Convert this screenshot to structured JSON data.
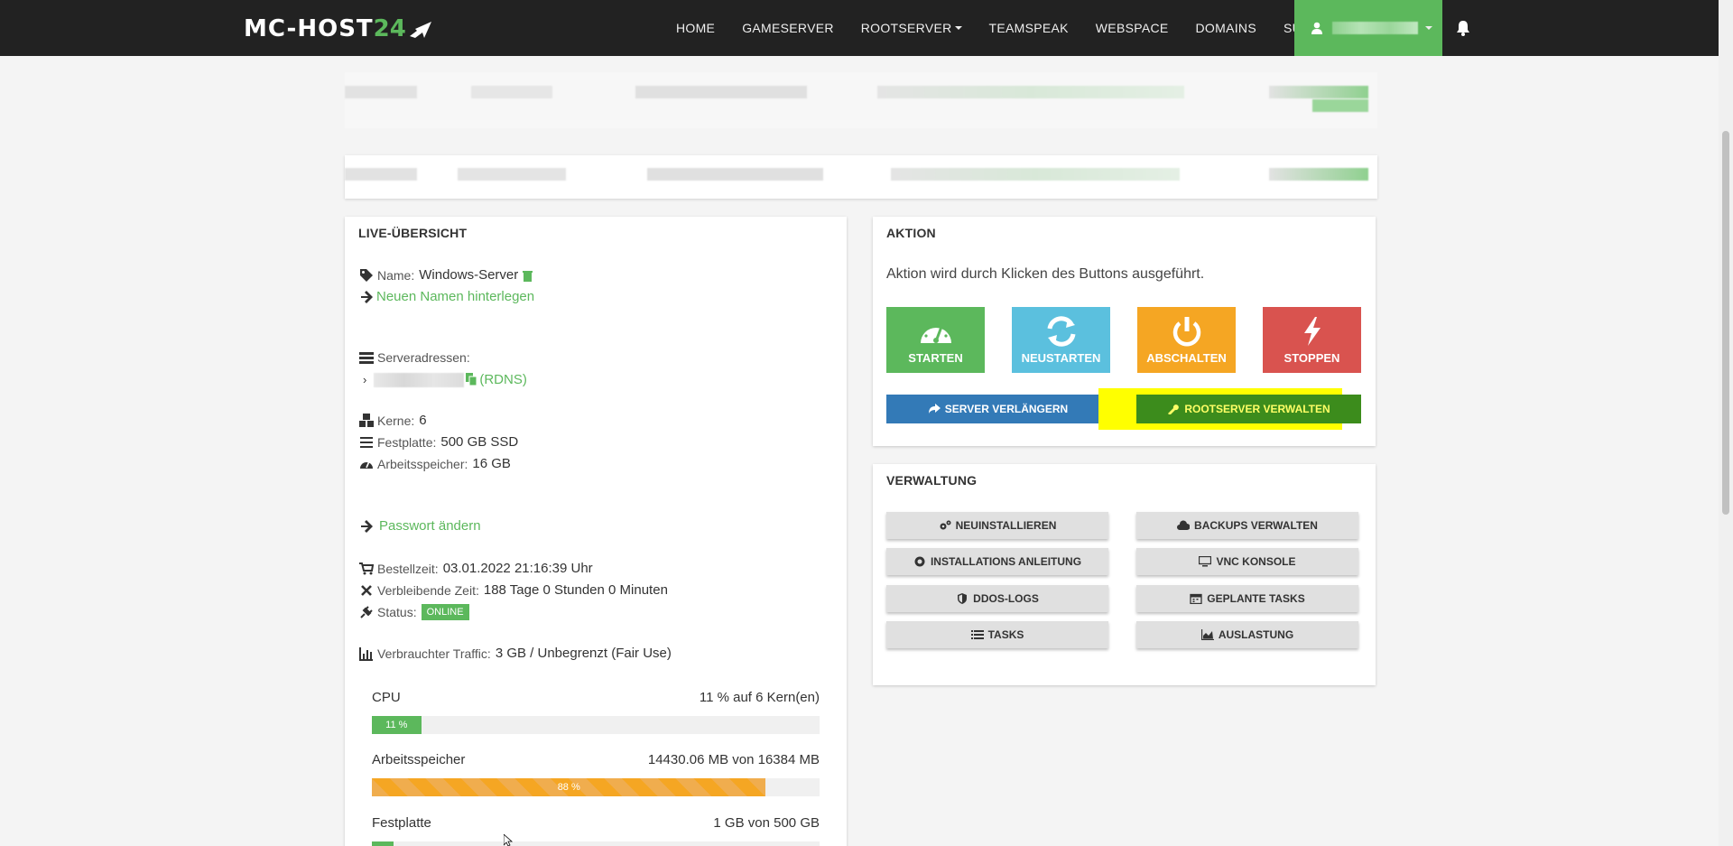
{
  "brand": {
    "logo_text": "MC-HOST",
    "logo_number": "24"
  },
  "nav": {
    "items": [
      {
        "label": "HOME"
      },
      {
        "label": "GAMESERVER"
      },
      {
        "label": "ROOTSERVER",
        "dropdown": true
      },
      {
        "label": "TEAMSPEAK"
      },
      {
        "label": "WEBSPACE"
      },
      {
        "label": "DOMAINS"
      },
      {
        "label": "SUPPORT",
        "dropdown": true
      }
    ],
    "user_icon": "user-icon",
    "bell_icon": "bell-icon"
  },
  "live": {
    "title": "LIVE-ÜBERSICHT",
    "name_label": "Name:",
    "name_value": "Windows-Server",
    "rename_link": "Neuen Namen hinterlegen",
    "addresses_label": "Serveradressen:",
    "rdns_link": "(RDNS)",
    "cores_label": "Kerne:",
    "cores_value": "6",
    "disk_label": "Festplatte:",
    "disk_value": "500 GB SSD",
    "ram_label": "Arbeitsspeicher:",
    "ram_value": "16 GB",
    "password_link": "Passwort ändern",
    "order_label": "Bestellzeit:",
    "order_value": "03.01.2022 21:16:39 Uhr",
    "remaining_label": "Verbleibende Zeit:",
    "remaining_value": "188 Tage 0 Stunden 0 Minuten",
    "status_label": "Status:",
    "status_value": "ONLINE",
    "traffic_label": "Verbrauchter Traffic:",
    "traffic_value": "3 GB / Unbegrenzt (Fair Use)",
    "bars": [
      {
        "label": "CPU",
        "value_text": "11 % auf 6 Kern(en)",
        "percent": 11,
        "fill_text": "11 %",
        "color": "#5cb85c"
      },
      {
        "label": "Arbeitsspeicher",
        "value_text": "14430.06 MB von 16384 MB",
        "percent": 88,
        "fill_text": "88 %",
        "color": "#f5a623"
      },
      {
        "label": "Festplatte",
        "value_text": "1 GB von 500 GB",
        "percent": 0.2,
        "fill_text": "",
        "color": "#5cb85c"
      }
    ]
  },
  "aktion": {
    "title": "AKTION",
    "description": "Aktion wird durch Klicken des Buttons ausgeführt.",
    "buttons": [
      {
        "label": "STARTEN",
        "color": "#5cb85c",
        "icon": "dashboard-icon"
      },
      {
        "label": "NEUSTARTEN",
        "color": "#5bc0de",
        "icon": "refresh-icon"
      },
      {
        "label": "ABSCHALTEN",
        "color": "#f5a623",
        "icon": "power-icon"
      },
      {
        "label": "STOPPEN",
        "color": "#d9534f",
        "icon": "bolt-icon"
      }
    ],
    "extend_label": "SERVER VERLÄNGERN",
    "extend_color": "#337ab7",
    "manage_label": "ROOTSERVER VERWALTEN",
    "manage_color": "#3c8c1c",
    "highlight_color": "#ffff00"
  },
  "verwaltung": {
    "title": "VERWALTUNG",
    "buttons": [
      {
        "label": "NEUINSTALLIEREN",
        "icon": "cogs-icon"
      },
      {
        "label": "BACKUPS VERWALTEN",
        "icon": "cloud-icon"
      },
      {
        "label": "INSTALLATIONS ANLEITUNG",
        "icon": "lifebuoy-icon"
      },
      {
        "label": "VNC KONSOLE",
        "icon": "monitor-icon"
      },
      {
        "label": "DDOS-LOGS",
        "icon": "shield-icon"
      },
      {
        "label": "GEPLANTE TASKS",
        "icon": "calendar-icon"
      },
      {
        "label": "TASKS",
        "icon": "list-icon"
      },
      {
        "label": "AUSLASTUNG",
        "icon": "area-chart-icon"
      }
    ]
  }
}
